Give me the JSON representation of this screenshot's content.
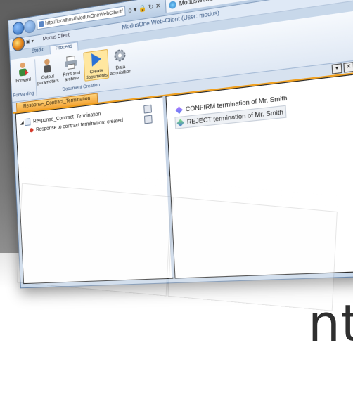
{
  "background": {
    "bottom_text": "nt"
  },
  "browser": {
    "address": "http://localhost/ModusOneWebClient/",
    "address_tools": "ρ ▾ 🔒 ↻ ✕",
    "tab_title": "ModusWebClient",
    "tab_close": "×",
    "window_buttons": {
      "minimize": "–",
      "maximize": "▢",
      "close": "✕"
    },
    "icons": "⌂ ☆ ⚙"
  },
  "app": {
    "client_name": "Modus Client",
    "window_title": "ModusOne Web-Client (User: modus)",
    "help": "?",
    "ribbon_tabs": [
      "Studio",
      "Process"
    ],
    "ribbon_buttons": [
      {
        "label": "Forward"
      },
      {
        "label": "Output parameters"
      },
      {
        "label": "Print and archive"
      },
      {
        "label": "Create documents"
      },
      {
        "label": "Data acquisition"
      }
    ],
    "group_labels": {
      "forwarding": "Forwarding",
      "document_creation": "Document Creation"
    }
  },
  "document": {
    "tab_title": "Response_Contract_Termination",
    "pane_controls": [
      "▾",
      "✕"
    ],
    "tree": {
      "root": "Response_Contract_Termination",
      "child": "Response to contract termination: created"
    },
    "actions": [
      {
        "label": "CONFIRM termination of Mr. Smith",
        "selected": false
      },
      {
        "label": "REJECT termination of Mr. Smith",
        "selected": true
      }
    ]
  }
}
